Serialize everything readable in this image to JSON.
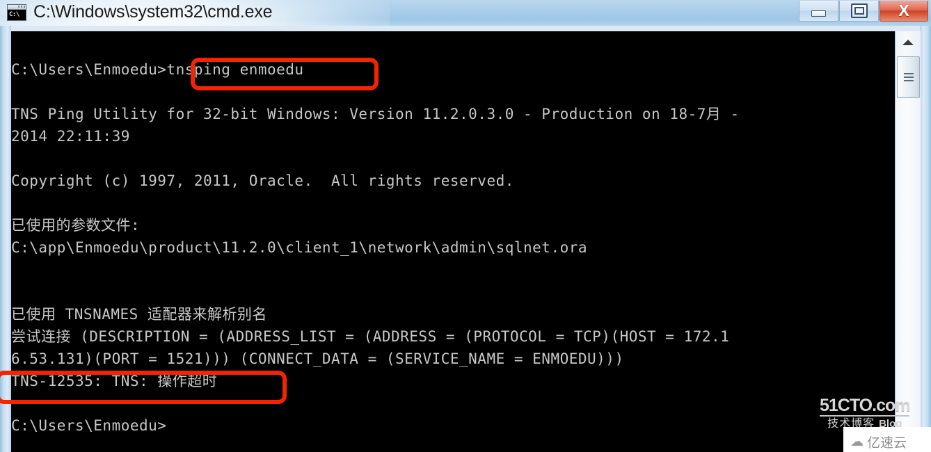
{
  "window": {
    "title": "C:\\Windows\\system32\\cmd.exe",
    "icon_name": "cmd-icon",
    "icon_text": "C:\\",
    "controls": {
      "minimize_label": "Minimize",
      "maximize_label": "Maximize",
      "close_label": "X"
    }
  },
  "console": {
    "lines": [
      "",
      "C:\\Users\\Enmoedu>tnsping enmoedu",
      "",
      "TNS Ping Utility for 32-bit Windows: Version 11.2.0.3.0 - Production on 18-7月 -",
      "2014 22:11:39",
      "",
      "Copyright (c) 1997, 2011, Oracle.  All rights reserved.",
      "",
      "已使用的参数文件:",
      "C:\\app\\Enmoedu\\product\\11.2.0\\client_1\\network\\admin\\sqlnet.ora",
      "",
      "",
      "已使用 TNSNAMES 适配器来解析别名",
      "尝试连接 (DESCRIPTION = (ADDRESS_LIST = (ADDRESS = (PROTOCOL = TCP)(HOST = 172.1",
      "6.53.131)(PORT = 1521))) (CONNECT_DATA = (SERVICE_NAME = ENMOEDU)))",
      "TNS-12535: TNS: 操作超时",
      "",
      "C:\\Users\\Enmoedu>"
    ],
    "command": "tnsping enmoedu",
    "error": "TNS-12535: TNS: 操作超时",
    "prompt": "C:\\Users\\Enmoedu>",
    "background_color": "#000000",
    "text_color": "#c8c8c8"
  },
  "annotations": {
    "accent_color": "#f42400",
    "command_box_label": "tnsping enmoedu",
    "error_box_label": "TNS-12535: TNS: 操作超时"
  },
  "scrollbar": {
    "up_arrow_name": "scroll-up-arrow",
    "position_percent": 6
  },
  "watermarks": {
    "cto_main": "51CTO.com",
    "cto_sub": "技术博客",
    "cto_blog": "Blog",
    "yisuyun": "亿速云",
    "yisuyun_icon": "cloud-icon"
  }
}
